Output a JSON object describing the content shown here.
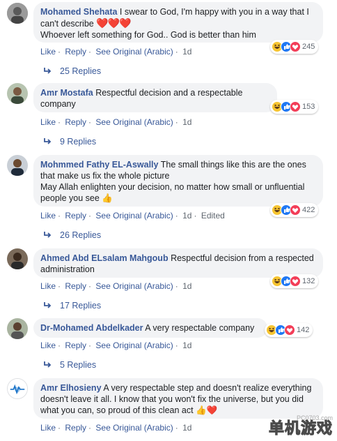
{
  "comments": [
    {
      "author": "Mohamed Shehata",
      "text": "I swear to God, I'm happy with you in a way that I can't describe",
      "text2": "Whoever left something for God.. God is better than him",
      "emoji": "❤️❤️❤️",
      "reaction_count": "245",
      "actions": {
        "like": "Like",
        "reply": "Reply",
        "see_original": "See Original (Arabic)",
        "time": "1d"
      },
      "replies": "25 Replies"
    },
    {
      "author": "Amr Mostafa",
      "text": "Respectful decision and a respectable company",
      "reaction_count": "153",
      "actions": {
        "like": "Like",
        "reply": "Reply",
        "see_original": "See Original (Arabic)",
        "time": "1d"
      },
      "replies": "9 Replies"
    },
    {
      "author": "Mohmmed Fathy EL-Aswally",
      "text": "The small things like this are the ones that make us fix the whole picture",
      "text2": "May Allah enlighten your decision, no matter how small or unfluential people you see",
      "emoji": "👍",
      "reaction_count": "422",
      "actions": {
        "like": "Like",
        "reply": "Reply",
        "see_original": "See Original (Arabic)",
        "time": "1d",
        "edited": "Edited"
      },
      "replies": "26 Replies"
    },
    {
      "author": "Ahmed Abd ELsalam Mahgoub",
      "text": "Respectful decision from a respected administration",
      "reaction_count": "132",
      "actions": {
        "like": "Like",
        "reply": "Reply",
        "see_original": "See Original (Arabic)",
        "time": "1d"
      },
      "replies": "17 Replies"
    },
    {
      "author": "Dr-Mohamed Abdelkader",
      "text": "A very respectable company",
      "reaction_count": "142",
      "actions": {
        "like": "Like",
        "reply": "Reply",
        "see_original": "See Original (Arabic)",
        "time": "1d"
      },
      "replies": "5 Replies"
    },
    {
      "author": "Amr Elhosieny",
      "text": "A very respectable step and doesn't realize everything doesn't leave it all. I know that you won't fix the universe, but you did what you can, so proud of this clean act",
      "emoji": "👍❤️",
      "actions": {
        "like": "Like",
        "reply": "Reply",
        "see_original": "See Original (Arabic)",
        "time": "1d"
      }
    }
  ],
  "watermark": {
    "url": "PC0703.com",
    "text": "单机游戏"
  },
  "colors": {
    "link": "#385898",
    "bubble": "#f2f3f5",
    "meta": "#606770",
    "heart": "#e0245e"
  },
  "icons": [
    "haha-reaction-icon",
    "like-reaction-icon",
    "love-reaction-icon",
    "reply-arrow-icon",
    "avatar"
  ]
}
